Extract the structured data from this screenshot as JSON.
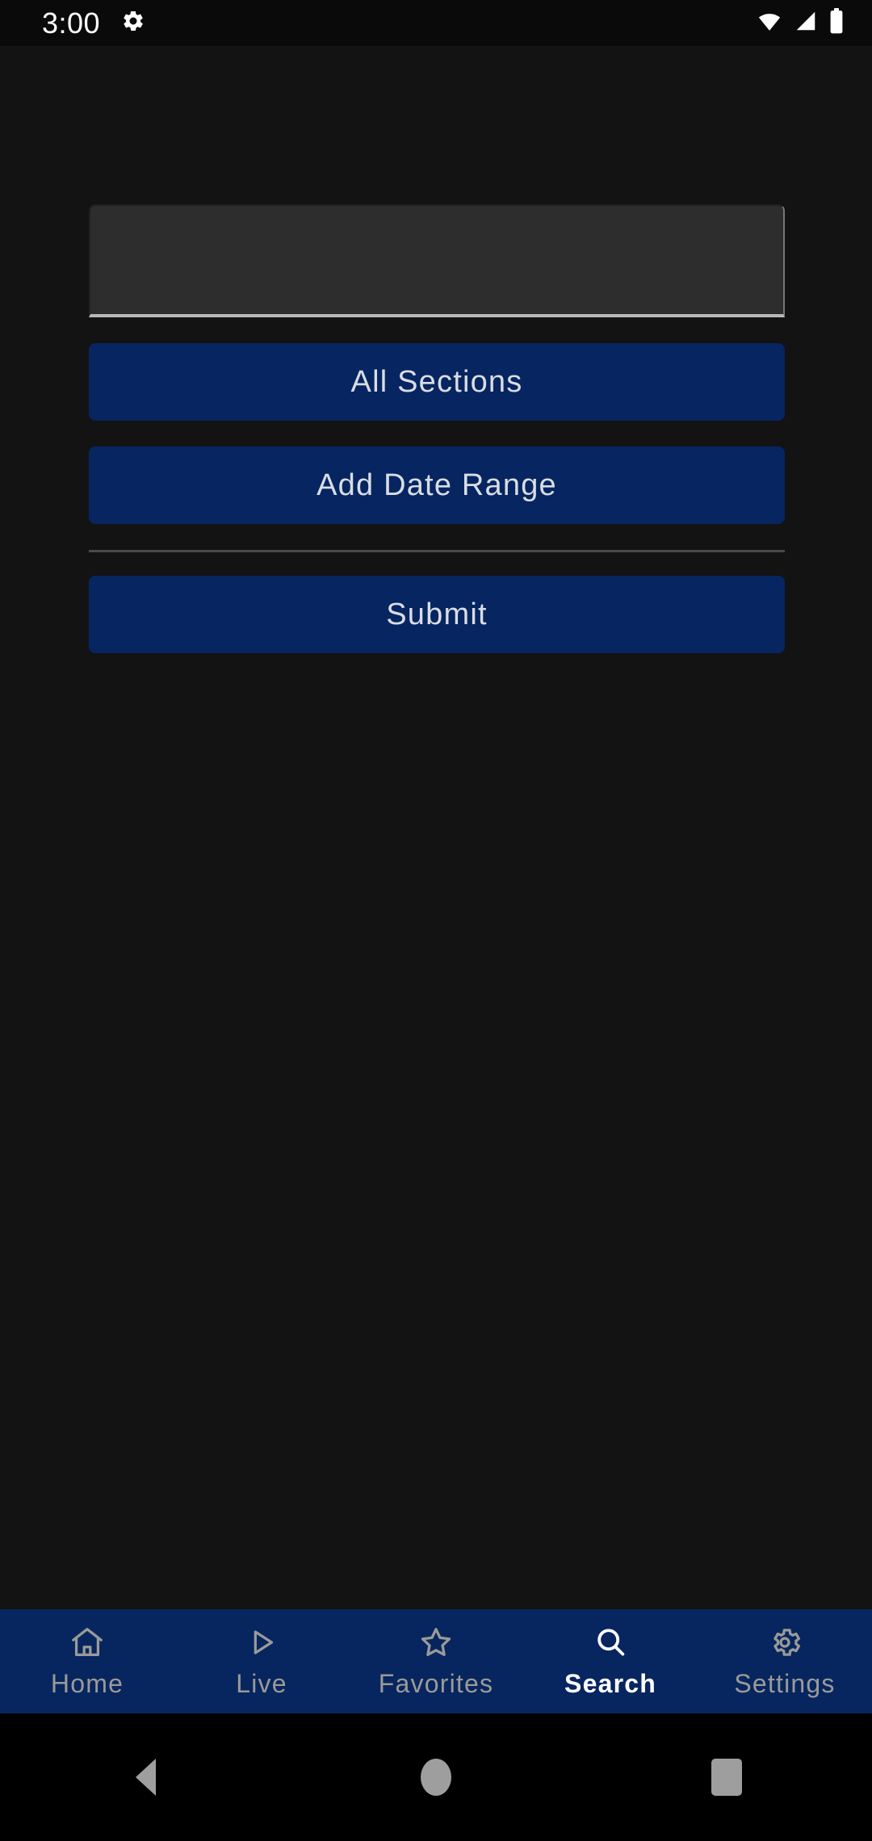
{
  "status_bar": {
    "time": "3:00",
    "icons": {
      "notification": "settings-gear-icon",
      "wifi": "wifi-icon",
      "signal": "cellular-signal-icon",
      "battery": "battery-full-icon"
    }
  },
  "search_form": {
    "query_input": {
      "value": "",
      "placeholder": ""
    },
    "sections_button": "All Sections",
    "date_range_button": "Add Date Range",
    "submit_button": "Submit"
  },
  "tab_bar": {
    "active": "Search",
    "items": [
      {
        "label": "Home",
        "icon": "home-icon"
      },
      {
        "label": "Live",
        "icon": "play-icon"
      },
      {
        "label": "Favorites",
        "icon": "star-icon"
      },
      {
        "label": "Search",
        "icon": "search-icon"
      },
      {
        "label": "Settings",
        "icon": "gear-icon"
      }
    ]
  },
  "system_nav": {
    "back": "back-button",
    "home": "home-button",
    "recents": "recents-button"
  },
  "colors": {
    "background": "#131313",
    "button": "#062561",
    "tab_bar": "#07265f",
    "field": "#2d2d2d",
    "accent_text": "#ffffff",
    "muted_text": "#9a9a98"
  }
}
